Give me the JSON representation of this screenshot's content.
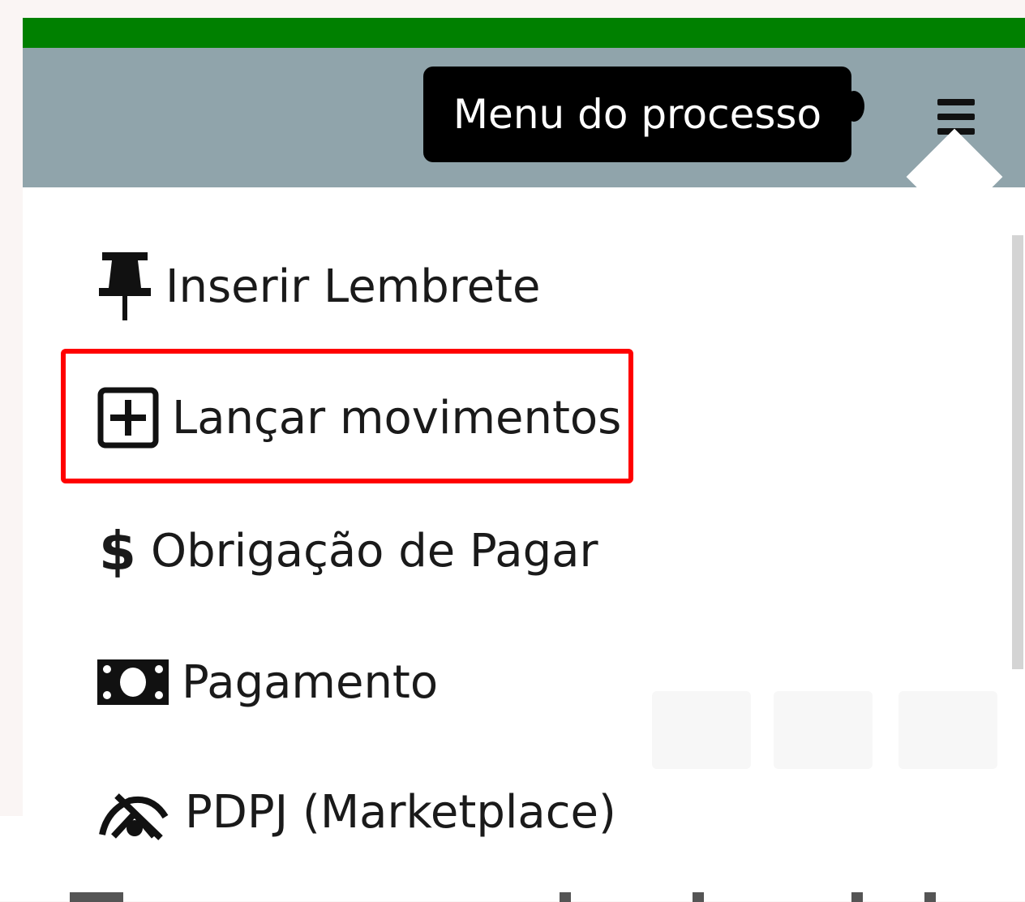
{
  "header": {
    "tooltip_text": "Menu do processo",
    "menu_button_icon": "hamburger-icon"
  },
  "menu": {
    "items": [
      {
        "label": "Inserir Lembrete",
        "icon": "pushpin-icon"
      },
      {
        "label": "Lançar movimentos",
        "icon": "plus-square-icon"
      },
      {
        "label": "Obrigação de Pagar",
        "icon": "dollar-sign-icon"
      },
      {
        "label": "Pagamento",
        "icon": "money-bill-icon"
      },
      {
        "label": "PDPJ (Marketplace)",
        "icon": "pdpj-logo-icon"
      }
    ],
    "highlighted_index": 1
  },
  "colors": {
    "top_bar": "#008000",
    "header_bg": "#90a4ab",
    "tooltip_bg": "#000000",
    "highlight_border": "#ff0000"
  }
}
